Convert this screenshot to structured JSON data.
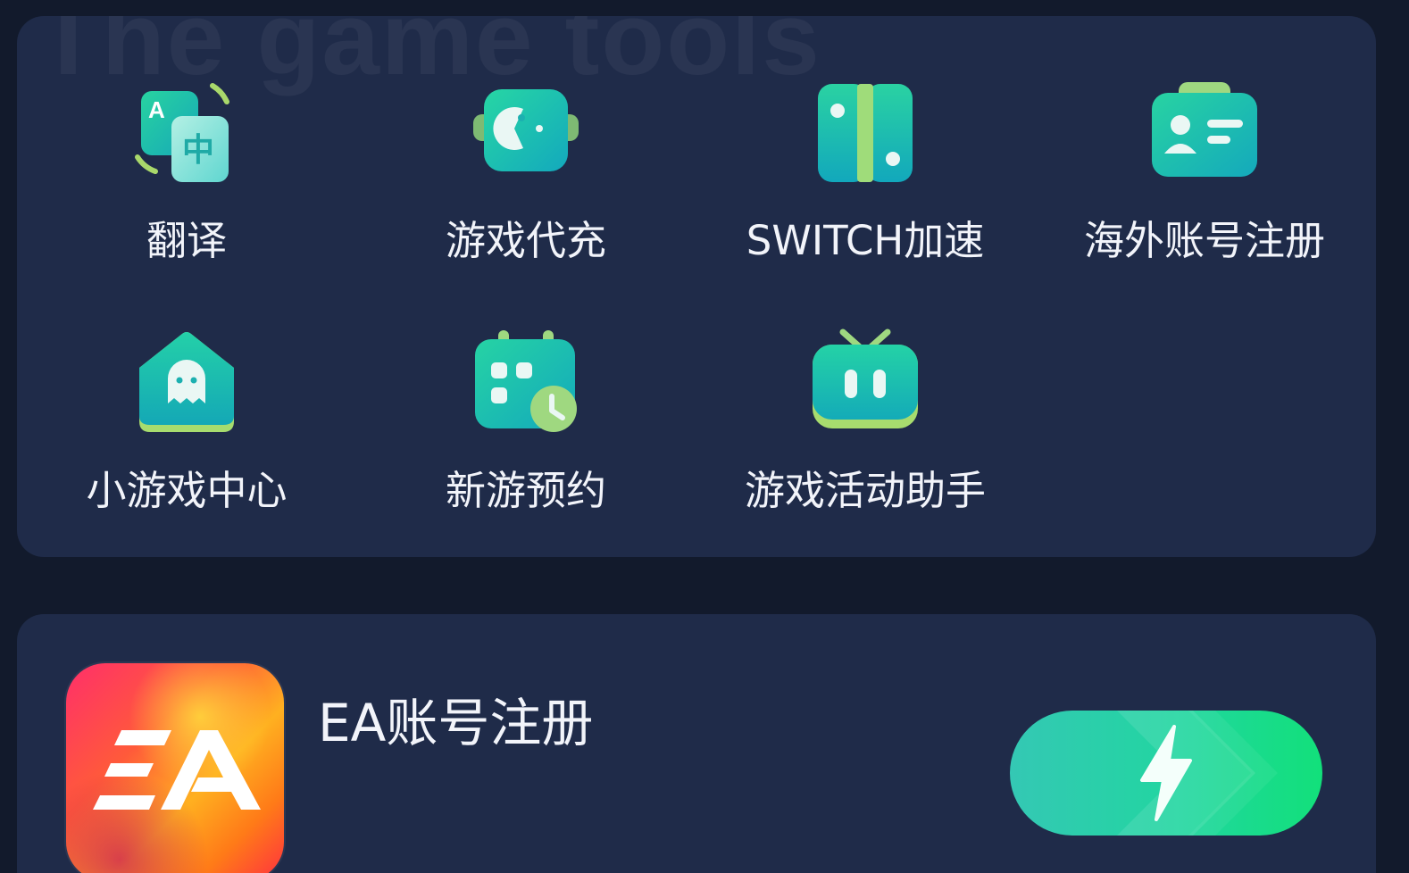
{
  "panel": {
    "watermark": "The game tools",
    "tools": [
      {
        "label": "翻译",
        "icon": "translate-icon"
      },
      {
        "label": "游戏代充",
        "icon": "game-recharge-icon"
      },
      {
        "label": "SWITCH加速",
        "icon": "switch-console-icon"
      },
      {
        "label": "海外账号注册",
        "icon": "id-card-icon"
      },
      {
        "label": "小游戏中心",
        "icon": "ghost-house-icon"
      },
      {
        "label": "新游预约",
        "icon": "calendar-clock-icon"
      },
      {
        "label": "游戏活动助手",
        "icon": "robot-tv-icon"
      }
    ]
  },
  "ea_card": {
    "logo_text": "EA",
    "title": "EA账号注册",
    "action_icon": "lightning-bolt-icon"
  },
  "colors": {
    "background": "#121a2c",
    "card": "#1f2b49",
    "accent_green": "#21d6a0",
    "accent_teal": "#1bb7c0",
    "text": "#f2f4fa"
  }
}
